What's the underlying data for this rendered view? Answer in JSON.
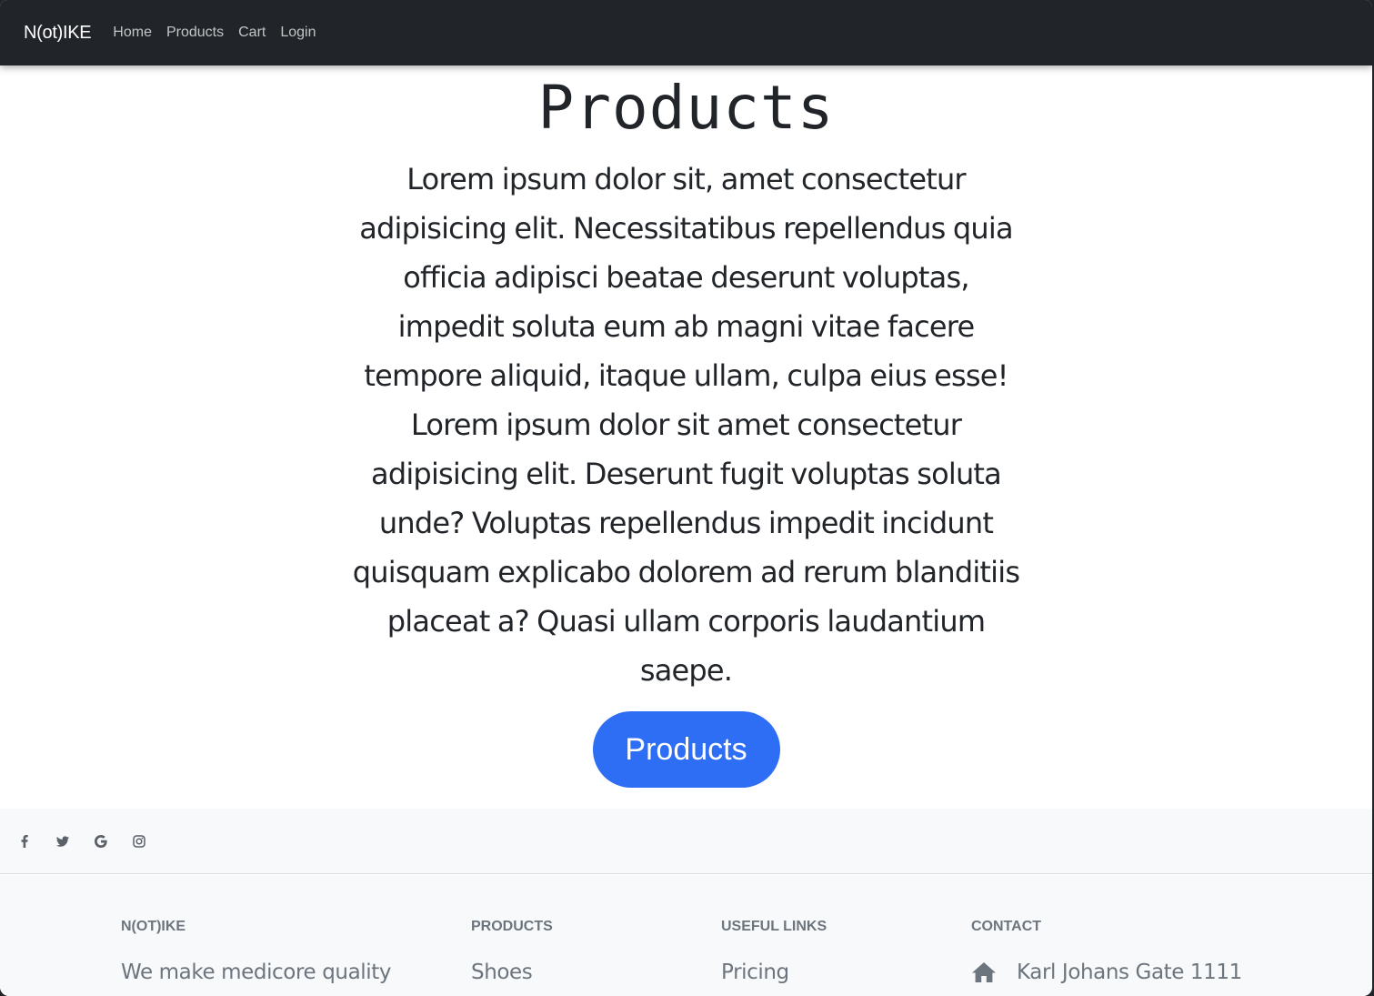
{
  "navbar": {
    "brand": "N(ot)IKE",
    "links": [
      "Home",
      "Products",
      "Cart",
      "Login"
    ]
  },
  "hero": {
    "title": "Products",
    "text": "Lorem ipsum dolor sit, amet consectetur adipisicing elit. Necessitatibus repellendus quia officia adipisci beatae deserunt voluptas, impedit soluta eum ab magni vitae facere tempore aliquid, itaque ullam, culpa eius esse! Lorem ipsum dolor sit amet consectetur adipisicing elit. Deserunt fugit voluptas soluta unde? Voluptas repellendus impedit incidunt quisquam explicabo dolorem ad rerum blanditiis placeat a? Quasi ullam corporis laudantium saepe.",
    "button_label": "Products",
    "button_color": "#2d6ef4"
  },
  "social": {
    "icons": [
      "facebook-icon",
      "twitter-icon",
      "google-icon",
      "instagram-icon"
    ]
  },
  "footer": {
    "columns": [
      {
        "title": "N(ot)IKE",
        "first_item": "We make medicore quality"
      },
      {
        "title": "Products",
        "first_item": "Shoes"
      },
      {
        "title": "Useful links",
        "first_item": "Pricing"
      },
      {
        "title": "Contact",
        "first_item": "Karl Johans Gate 1111",
        "icon": "home-icon"
      }
    ]
  },
  "colors": {
    "navbar_bg": "#212529",
    "footer_bg": "#f8f9fa",
    "muted_text": "#6c757d"
  }
}
